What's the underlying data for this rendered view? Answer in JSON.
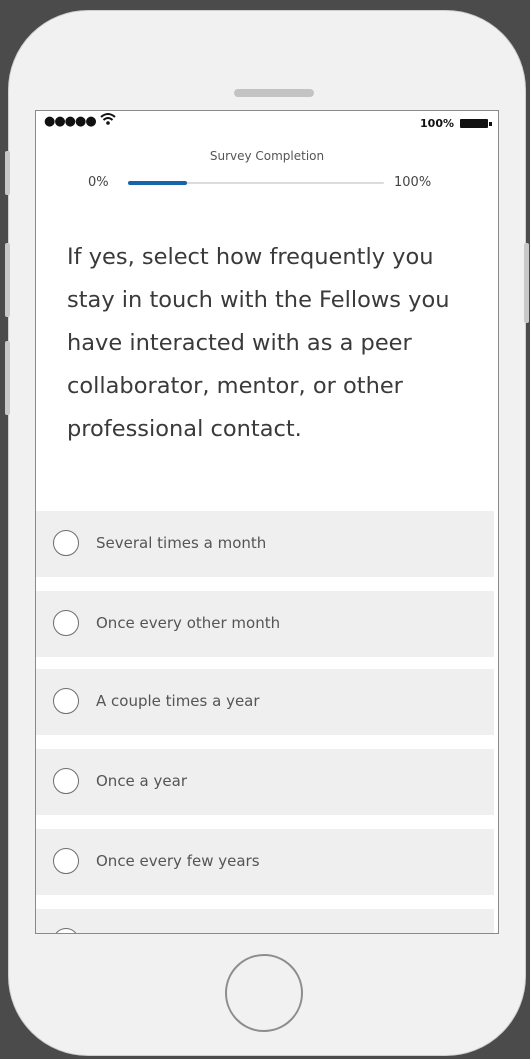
{
  "status_bar": {
    "signal": "●●●●●",
    "wifi_icon": "wifi-icon",
    "battery_text": "100%",
    "battery_icon": "battery-icon"
  },
  "progress": {
    "title": "Survey Completion",
    "start_label": "0%",
    "end_label": "100%",
    "value_fraction": 0.23
  },
  "question": {
    "text": "If yes, select how frequently you stay in touch with the Fellows you have interacted with as a peer collaborator, mentor, or other professional contact."
  },
  "options": [
    {
      "label": "Several times a month"
    },
    {
      "label": "Once every other month"
    },
    {
      "label": "A couple times a year"
    },
    {
      "label": "Once a year"
    },
    {
      "label": "Once every few years"
    }
  ],
  "colors": {
    "accent": "#1565a8",
    "option_bg": "#efefef"
  }
}
